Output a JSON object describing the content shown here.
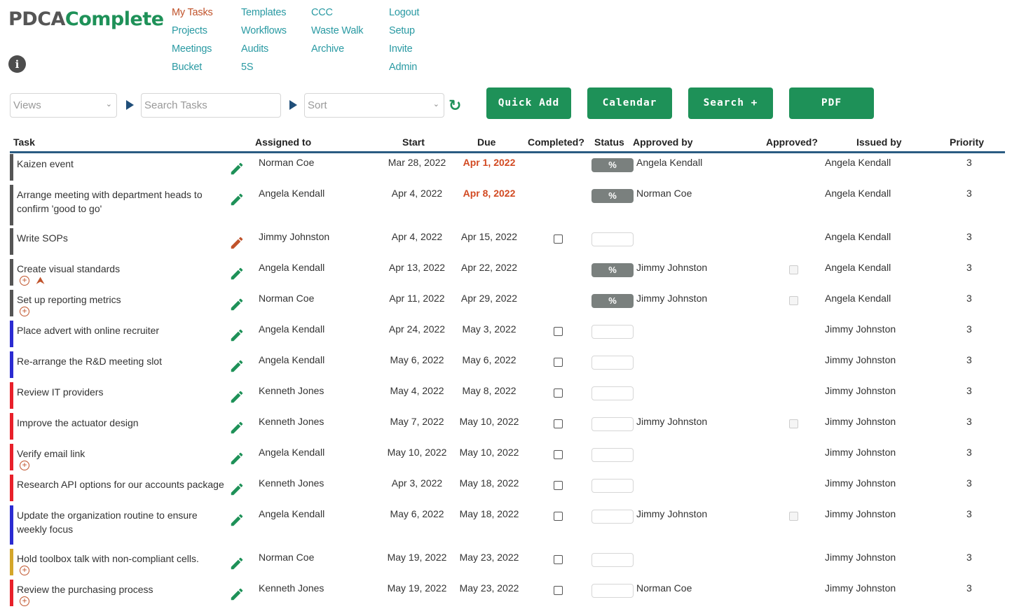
{
  "logo": {
    "part1": "PDCA",
    "part2": "Complete"
  },
  "nav": {
    "col1": [
      "My Tasks",
      "Projects",
      "Meetings",
      "Bucket"
    ],
    "col2": [
      "Templates",
      "Workflows",
      "Audits",
      "5S"
    ],
    "col3": [
      "CCC",
      "Waste Walk",
      "Archive"
    ],
    "col4": [
      "Logout",
      "Setup",
      "Invite",
      "Admin"
    ],
    "active": "My Tasks"
  },
  "toolbar": {
    "views_placeholder": "Views",
    "search_placeholder": "Search Tasks",
    "sort_placeholder": "Sort",
    "buttons": [
      "Quick Add",
      "Calendar",
      "Search +",
      "PDF"
    ]
  },
  "headers": {
    "task": "Task",
    "assigned": "Assigned to",
    "start": "Start",
    "due": "Due",
    "completed": "Completed?",
    "status": "Status",
    "approved_by": "Approved by",
    "approved": "Approved?",
    "issued_by": "Issued by",
    "priority": "Priority"
  },
  "colors": {
    "green": "#1e9158",
    "orange": "#c0532b",
    "teal": "#2a9aa3",
    "navy": "#2a5c82"
  },
  "tasks": [
    {
      "task": "Kaizen event",
      "assigned": "Norman Coe",
      "start": "Mar 28, 2022",
      "due": "Apr 1, 2022",
      "overdue": true,
      "completed": null,
      "status": "%",
      "approved_by": "Angela Kendall",
      "approved": null,
      "issued_by": "Angela Kendall",
      "priority": "3",
      "bar": "#555555",
      "pencil": "green",
      "icons": []
    },
    {
      "task": "Arrange meeting with department heads to confirm 'good to go'",
      "assigned": "Angela Kendall",
      "start": "Apr 4, 2022",
      "due": "Apr 8, 2022",
      "overdue": true,
      "completed": null,
      "status": "%",
      "approved_by": "Norman Coe",
      "approved": null,
      "issued_by": "Angela Kendall",
      "priority": "3",
      "bar": "#555555",
      "pencil": "green",
      "icons": []
    },
    {
      "task": "Write SOPs",
      "assigned": "Jimmy Johnston",
      "start": "Apr 4, 2022",
      "due": "Apr 15, 2022",
      "overdue": false,
      "completed": false,
      "status": "",
      "approved_by": "",
      "approved": null,
      "issued_by": "Angela Kendall",
      "priority": "3",
      "bar": "#555555",
      "pencil": "orange",
      "icons": []
    },
    {
      "task": "Create visual standards",
      "assigned": "Angela Kendall",
      "start": "Apr 13, 2022",
      "due": "Apr 22, 2022",
      "overdue": false,
      "completed": null,
      "status": "%",
      "approved_by": "Jimmy Johnston",
      "approved": false,
      "issued_by": "Angela Kendall",
      "priority": "3",
      "bar": "#555555",
      "pencil": "green",
      "icons": [
        "plus",
        "upload"
      ]
    },
    {
      "task": "Set up reporting metrics",
      "assigned": "Norman Coe",
      "start": "Apr 11, 2022",
      "due": "Apr 29, 2022",
      "overdue": false,
      "completed": null,
      "status": "%",
      "approved_by": "Jimmy Johnston",
      "approved": false,
      "issued_by": "Angela Kendall",
      "priority": "3",
      "bar": "#555555",
      "pencil": "green",
      "icons": [
        "plus"
      ]
    },
    {
      "task": "Place advert with online recruiter",
      "assigned": "Angela Kendall",
      "start": "Apr 24, 2022",
      "due": "May 3, 2022",
      "overdue": false,
      "completed": false,
      "status": "",
      "approved_by": "",
      "approved": null,
      "issued_by": "Jimmy Johnston",
      "priority": "3",
      "bar": "#2b2bd1",
      "pencil": "green",
      "icons": []
    },
    {
      "task": "Re-arrange the R&D meeting slot",
      "assigned": "Angela Kendall",
      "start": "May 6, 2022",
      "due": "May 6, 2022",
      "overdue": false,
      "completed": false,
      "status": "",
      "approved_by": "",
      "approved": null,
      "issued_by": "Jimmy Johnston",
      "priority": "3",
      "bar": "#2b2bd1",
      "pencil": "green",
      "icons": []
    },
    {
      "task": "Review IT providers",
      "assigned": "Kenneth Jones",
      "start": "May 4, 2022",
      "due": "May 8, 2022",
      "overdue": false,
      "completed": false,
      "status": "",
      "approved_by": "",
      "approved": null,
      "issued_by": "Jimmy Johnston",
      "priority": "3",
      "bar": "#e8202a",
      "pencil": "green",
      "icons": []
    },
    {
      "task": "Improve the actuator design",
      "assigned": "Kenneth Jones",
      "start": "May 7, 2022",
      "due": "May 10, 2022",
      "overdue": false,
      "completed": false,
      "status": "",
      "approved_by": "Jimmy Johnston",
      "approved": false,
      "issued_by": "Jimmy Johnston",
      "priority": "3",
      "bar": "#e8202a",
      "pencil": "green",
      "icons": []
    },
    {
      "task": "Verify email link",
      "assigned": "Angela Kendall",
      "start": "May 10, 2022",
      "due": "May 10, 2022",
      "overdue": false,
      "completed": false,
      "status": "",
      "approved_by": "",
      "approved": null,
      "issued_by": "Jimmy Johnston",
      "priority": "3",
      "bar": "#e8202a",
      "pencil": "green",
      "icons": [
        "plus"
      ]
    },
    {
      "task": "Research API options for our accounts package",
      "assigned": "Kenneth Jones",
      "start": "Apr 3, 2022",
      "due": "May 18, 2022",
      "overdue": false,
      "completed": false,
      "status": "",
      "approved_by": "",
      "approved": null,
      "issued_by": "Jimmy Johnston",
      "priority": "3",
      "bar": "#e8202a",
      "pencil": "green",
      "icons": []
    },
    {
      "task": "Update the organization routine to ensure weekly focus",
      "assigned": "Angela Kendall",
      "start": "May 6, 2022",
      "due": "May 18, 2022",
      "overdue": false,
      "completed": false,
      "status": "",
      "approved_by": "Jimmy Johnston",
      "approved": false,
      "issued_by": "Jimmy Johnston",
      "priority": "3",
      "bar": "#2b2bd1",
      "pencil": "green",
      "icons": []
    },
    {
      "task": "Hold toolbox talk with non-compliant cells.",
      "assigned": "Norman Coe",
      "start": "May 19, 2022",
      "due": "May 23, 2022",
      "overdue": false,
      "completed": false,
      "status": "",
      "approved_by": "",
      "approved": null,
      "issued_by": "Jimmy Johnston",
      "priority": "3",
      "bar": "#d4a62a",
      "pencil": "green",
      "icons": [
        "plus"
      ]
    },
    {
      "task": "Review the purchasing process",
      "assigned": "Kenneth Jones",
      "start": "May 19, 2022",
      "due": "May 23, 2022",
      "overdue": false,
      "completed": false,
      "status": "",
      "approved_by": "Norman Coe",
      "approved": null,
      "issued_by": "Jimmy Johnston",
      "priority": "3",
      "bar": "#e8202a",
      "pencil": "green",
      "icons": [
        "plus"
      ]
    }
  ]
}
